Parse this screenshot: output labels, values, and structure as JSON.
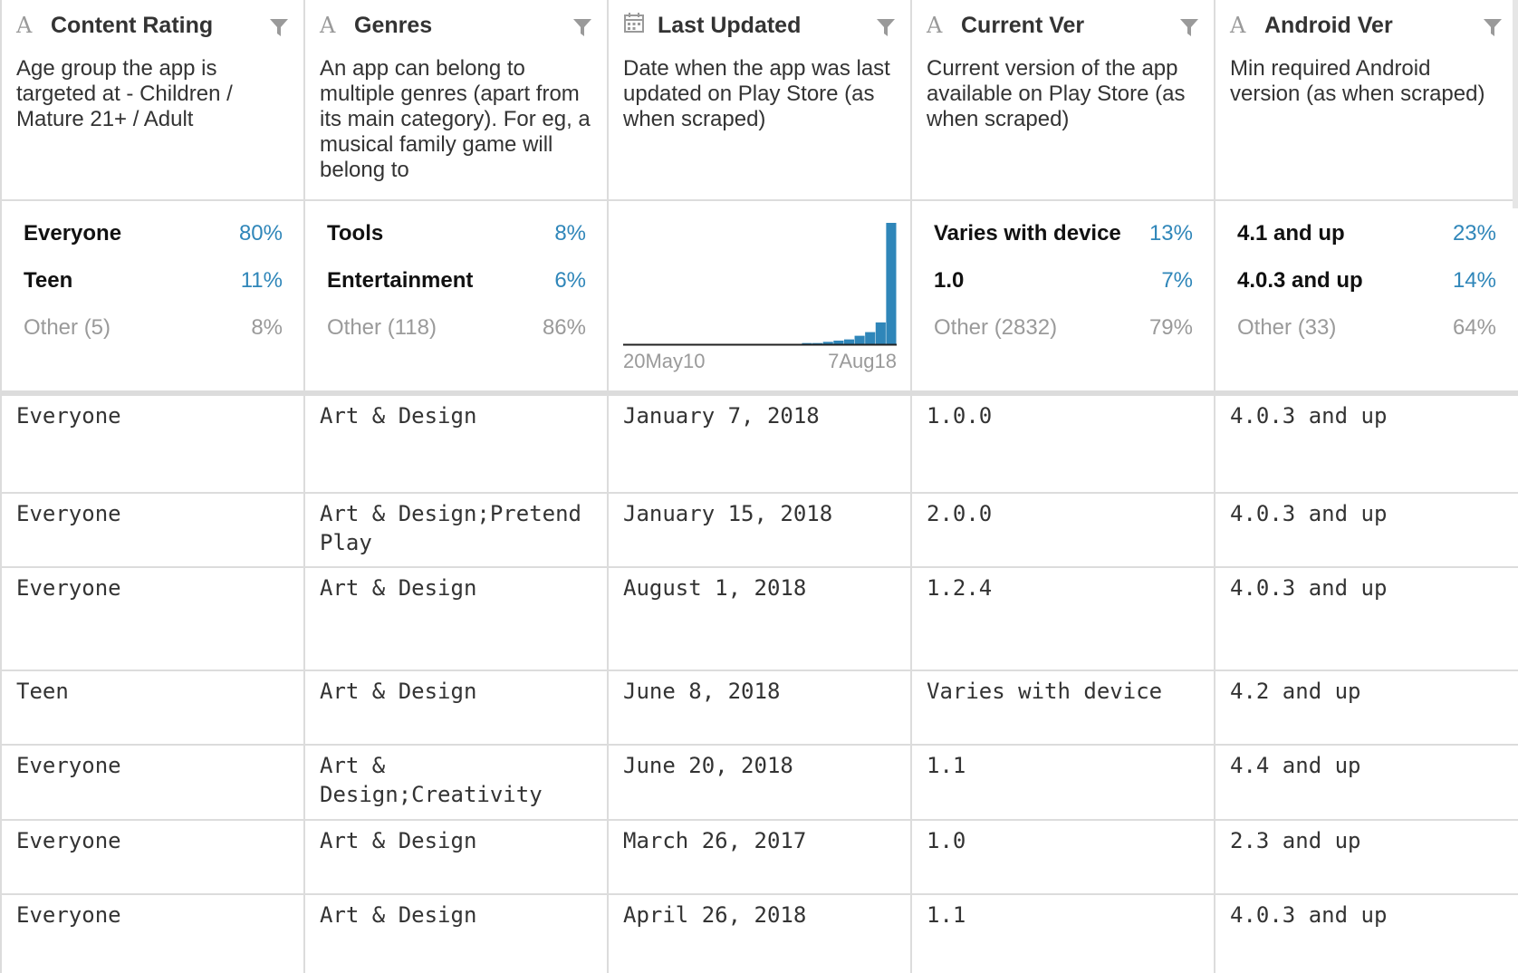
{
  "columns": [
    {
      "icon": "text-type-icon",
      "icon_glyph": "A",
      "title": "Content Rating",
      "description": "Age group the app is targeted at - Children / Mature 21+ / Adult",
      "summary": [
        {
          "label": "Everyone",
          "pct": "80%"
        },
        {
          "label": "Teen",
          "pct": "11%"
        },
        {
          "label": "Other (5)",
          "pct": "8%",
          "other": true
        }
      ]
    },
    {
      "icon": "text-type-icon",
      "icon_glyph": "A",
      "title": "Genres",
      "description": "An app can belong to multiple genres (apart from its main category). For eg, a musical family game will belong to",
      "summary": [
        {
          "label": "Tools",
          "pct": "8%"
        },
        {
          "label": "Entertainment",
          "pct": "6%"
        },
        {
          "label": "Other (118)",
          "pct": "86%",
          "other": true
        }
      ]
    },
    {
      "icon": "calendar-type-icon",
      "title": "Last Updated",
      "description": "Date when the app was last updated on Play Store (as when scraped)",
      "histogram": {
        "start_label": "20May10",
        "end_label": "7Aug18"
      }
    },
    {
      "icon": "text-type-icon",
      "icon_glyph": "A",
      "title": "Current Ver",
      "description": "Current version of the app available on Play Store (as when scraped)",
      "summary": [
        {
          "label": "Varies with device",
          "pct": "13%"
        },
        {
          "label": "1.0",
          "pct": "7%"
        },
        {
          "label": "Other (2832)",
          "pct": "79%",
          "other": true
        }
      ]
    },
    {
      "icon": "text-type-icon",
      "icon_glyph": "A",
      "title": "Android Ver",
      "description": "Min required Android version (as when scraped)",
      "summary": [
        {
          "label": "4.1 and up",
          "pct": "23%"
        },
        {
          "label": "4.0.3 and up",
          "pct": "14%"
        },
        {
          "label": "Other (33)",
          "pct": "64%",
          "other": true
        }
      ]
    }
  ],
  "chart_data": {
    "type": "bar",
    "x_range": [
      "20May10",
      "7Aug18"
    ],
    "values": [
      0,
      0,
      0,
      0,
      0,
      0,
      0,
      0,
      0,
      0,
      0,
      0,
      0,
      0,
      0,
      0,
      0,
      1,
      1,
      2,
      3,
      4,
      7,
      10,
      18,
      100
    ],
    "ylim": [
      0,
      100
    ]
  },
  "rows": [
    [
      "Everyone",
      "Art & Design",
      "January 7, 2018",
      "1.0.0",
      "4.0.3 and up"
    ],
    [
      "Everyone",
      "Art & Design;Pretend Play",
      "January 15, 2018",
      "2.0.0",
      "4.0.3 and up"
    ],
    [
      "Everyone",
      "Art & Design",
      "August 1, 2018",
      "1.2.4",
      "4.0.3 and up"
    ],
    [
      "Teen",
      "Art & Design",
      "June 8, 2018",
      "Varies with device",
      "4.2 and up"
    ],
    [
      "Everyone",
      "Art & Design;Creativity",
      "June 20, 2018",
      "1.1",
      "4.4 and up"
    ],
    [
      "Everyone",
      "Art & Design",
      "March 26, 2017",
      "1.0",
      "2.3 and up"
    ],
    [
      "Everyone",
      "Art & Design",
      "April 26, 2018",
      "1.1",
      "4.0.3 and up"
    ]
  ],
  "colors": {
    "accent": "#2f86b9",
    "muted": "#9a9a9a",
    "border": "#dcdcdc"
  }
}
